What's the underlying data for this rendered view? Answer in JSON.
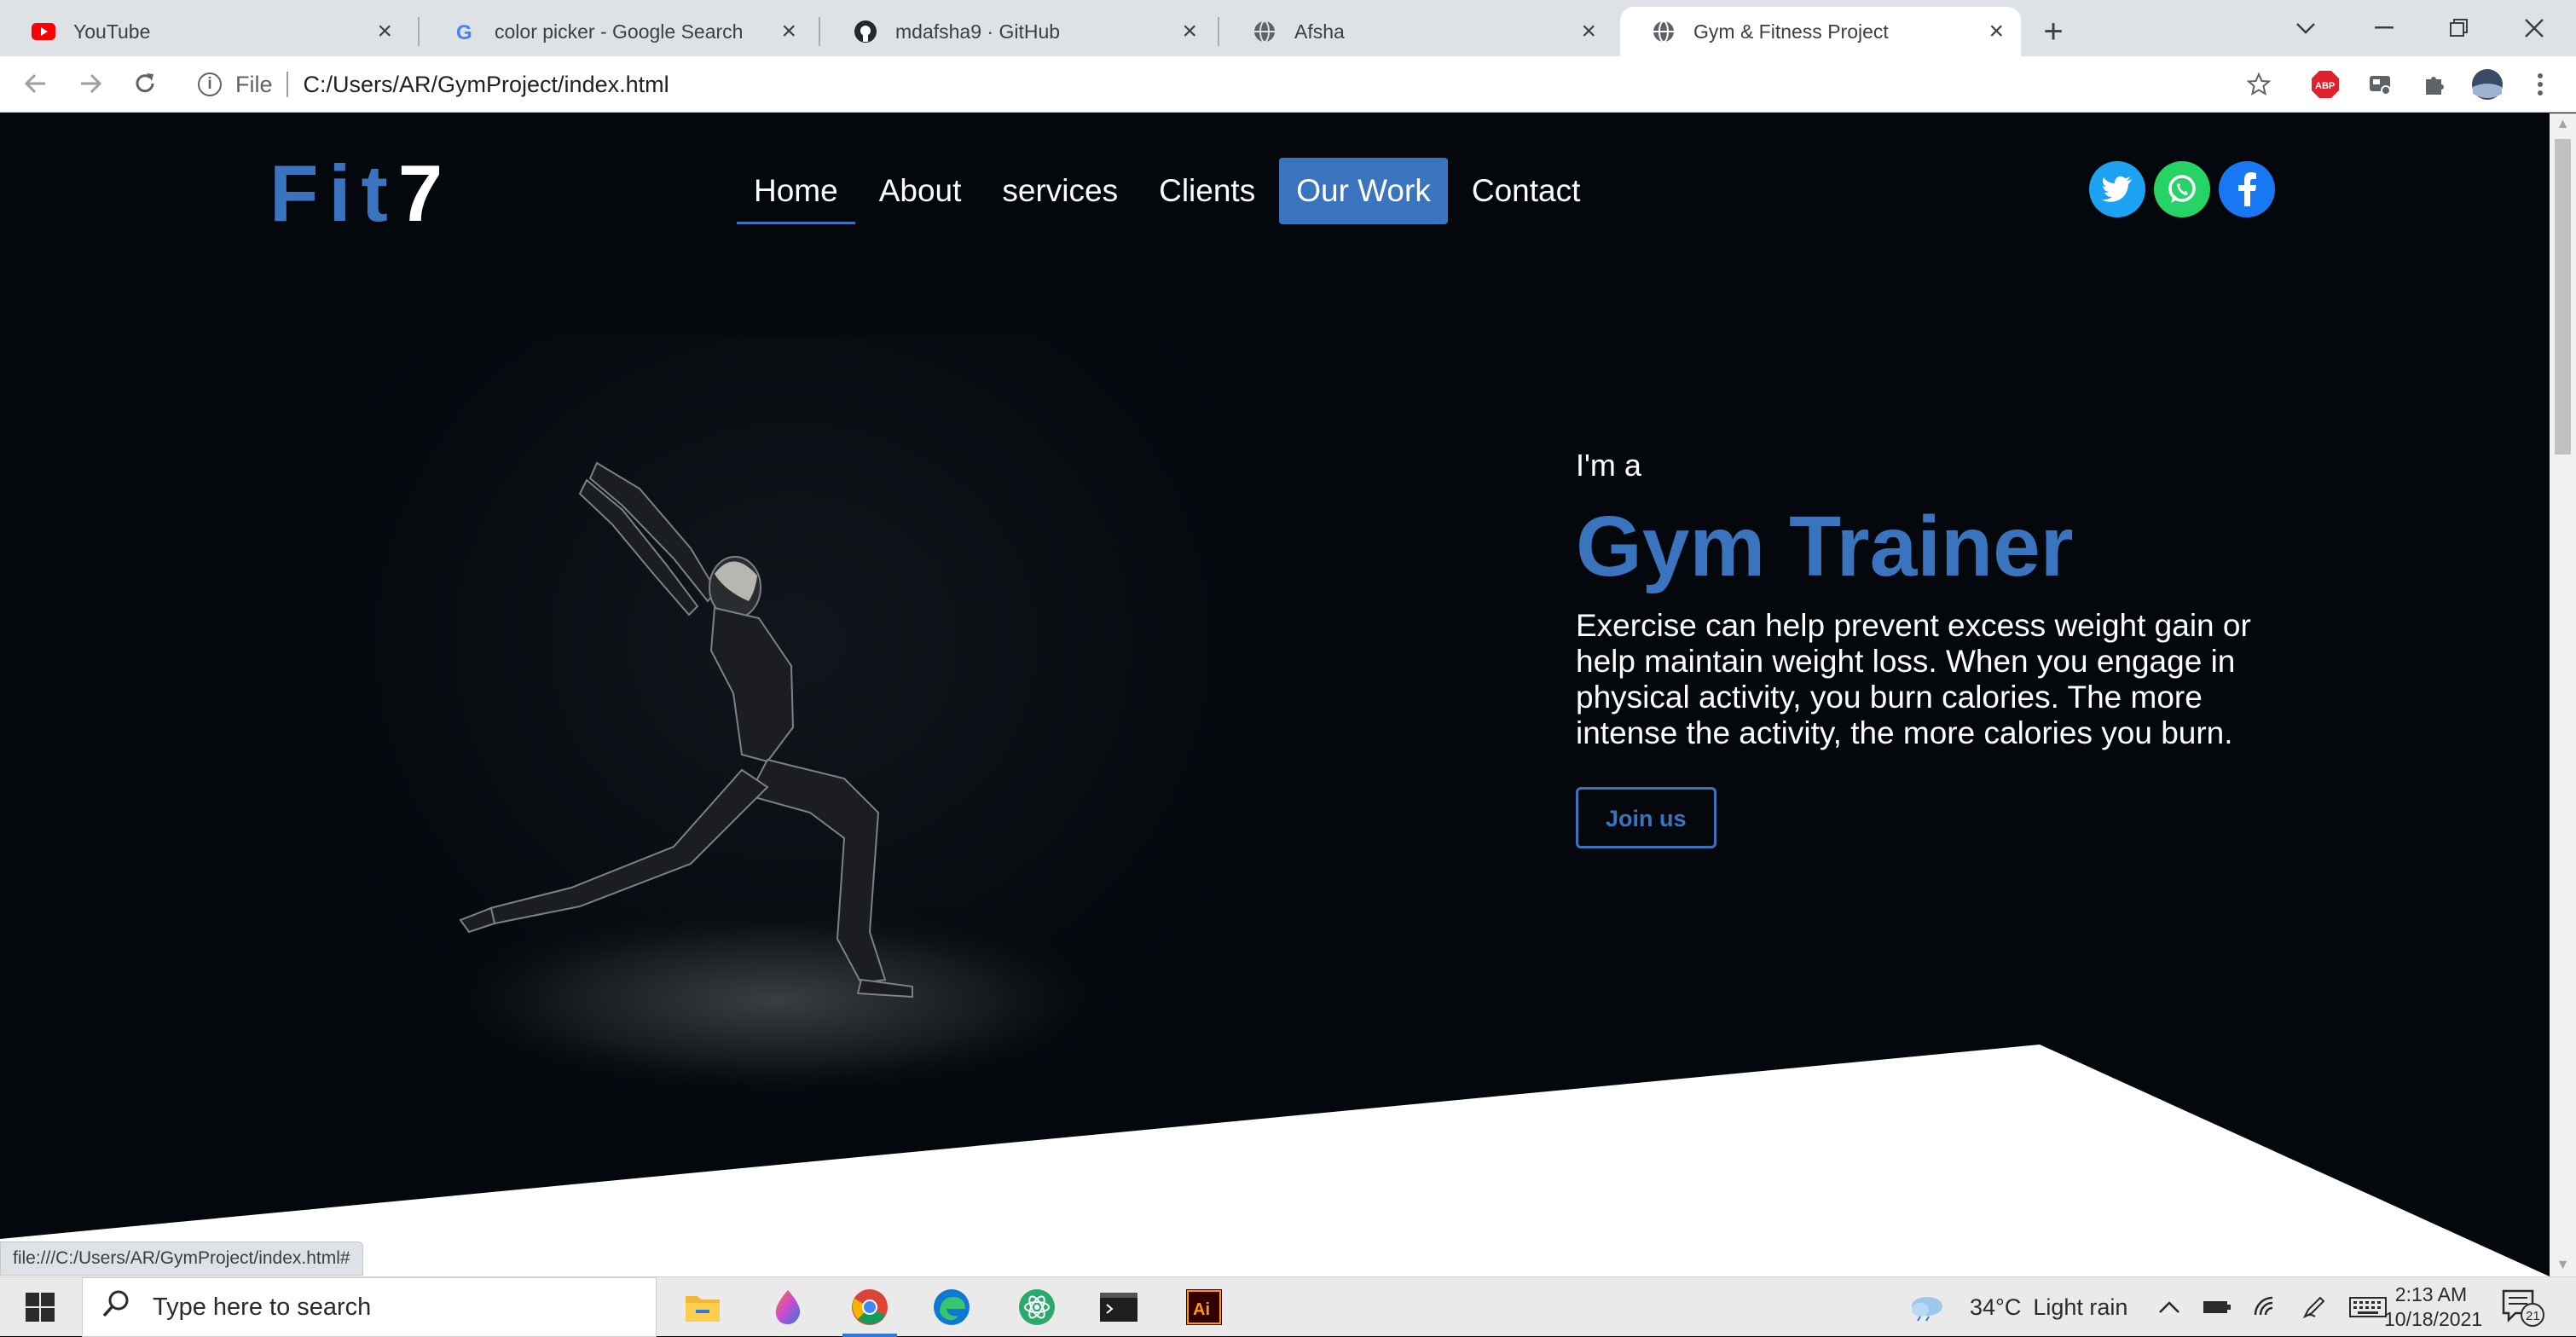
{
  "browser": {
    "tabs": [
      {
        "title": "YouTube",
        "icon": "youtube-icon"
      },
      {
        "title": "color picker - Google Search",
        "icon": "google-icon"
      },
      {
        "title": "mdafsha9 · GitHub",
        "icon": "github-icon"
      },
      {
        "title": "Afsha",
        "icon": "globe-icon"
      },
      {
        "title": "Gym & Fitness Project",
        "icon": "globe-icon",
        "active": true
      }
    ],
    "address": {
      "scheme": "File",
      "path": "C:/Users/AR/GymProject/index.html"
    },
    "status_url": "file:///C:/Users/AR/GymProject/index.html#",
    "extensions": [
      "star-icon",
      "adblock-icon",
      "extension-icon",
      "puzzle-icon",
      "profile-avatar",
      "menu-icon"
    ]
  },
  "site": {
    "logo": {
      "text": "Fit",
      "num": "7"
    },
    "nav": [
      "Home",
      "About",
      "services",
      "Clients",
      "Our Work",
      "Contact"
    ],
    "active_nav": "Home",
    "highlighted_nav": "Our Work",
    "socials": [
      "twitter-icon",
      "whatsapp-icon",
      "facebook-icon"
    ],
    "hero": {
      "pre": "I'm a",
      "title": "Gym Trainer",
      "description": "Exercise can help prevent excess weight gain or help maintain weight loss. When you engage in physical activity, you burn calories. The more intense the activity, the more calories you burn.",
      "cta": "Join us"
    },
    "colors": {
      "accent": "#3b74be",
      "background": "#04080d",
      "text": "#ffffff"
    }
  },
  "taskbar": {
    "search_placeholder": "Type here to search",
    "apps": [
      "file-explorer-icon",
      "paint-drop-icon",
      "chrome-icon",
      "edge-icon",
      "atom-icon",
      "terminal-icon",
      "illustrator-icon"
    ],
    "weather": {
      "temp": "34°C",
      "condition": "Light rain"
    },
    "time": "2:13 AM",
    "date": "10/18/2021",
    "notifications": "21"
  }
}
